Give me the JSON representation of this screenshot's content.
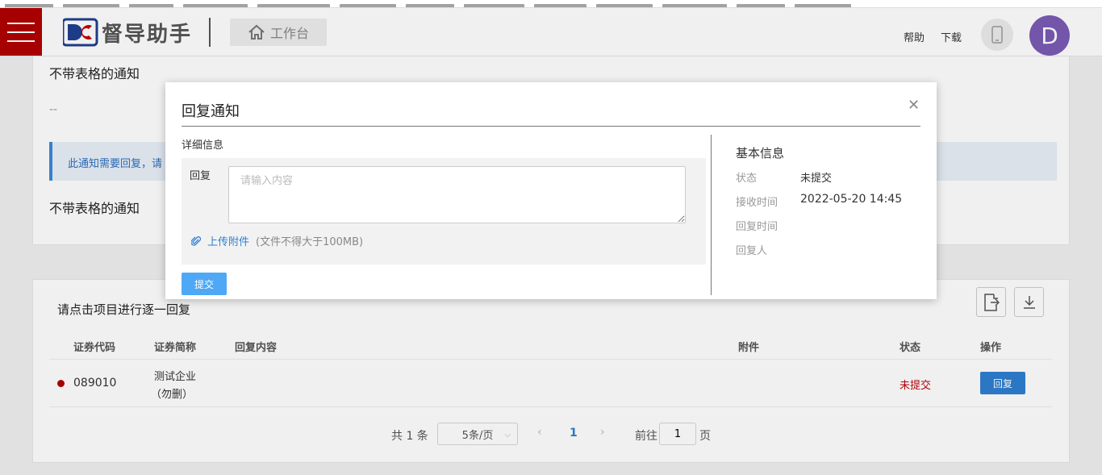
{
  "header": {
    "app_name": "督导助手",
    "workbench_label": "工作台",
    "help_label": "帮助",
    "download_label": "下载",
    "avatar_letter": "D"
  },
  "page": {
    "notice_title": "不带表格的通知",
    "notice_content": "--",
    "reply_hint": "此通知需要回复，请",
    "notice_title_2": "不带表格的通知",
    "list_title": "请点击项目进行逐一回复",
    "table": {
      "headers": [
        "证券代码",
        "证券简称",
        "回复内容",
        "附件",
        "状态",
        "操作"
      ],
      "rows": [
        {
          "code": "089010",
          "name_line1": "测试企业",
          "name_line2": "（勿删）",
          "reply": "",
          "attachment": "",
          "status": "未提交",
          "action": "回复"
        }
      ]
    },
    "pager": {
      "total": "共 1 条",
      "page_size": "5条/页",
      "current_page": "1",
      "goto_label": "前往",
      "goto_value": "1",
      "page_unit": "页"
    }
  },
  "modal": {
    "title": "回复通知",
    "details_label": "详细信息",
    "reply_label": "回复",
    "reply_placeholder": "请输入内容",
    "upload_label": "上传附件",
    "upload_hint": "(文件不得大于100MB)",
    "submit_label": "提交",
    "basic_info_title": "基本信息",
    "status_key": "状态",
    "status_value": "未提交",
    "received_key": "接收时间",
    "received_value": "2022-05-20 14:45",
    "reply_time_key": "回复时间",
    "replier_key": "回复人"
  },
  "colors": {
    "brand_red": "#b10000",
    "primary_blue": "#2f7fd1",
    "submit_blue": "#4ea8f5",
    "status_red": "#c0000a",
    "avatar_purple": "#7b5bb5"
  }
}
